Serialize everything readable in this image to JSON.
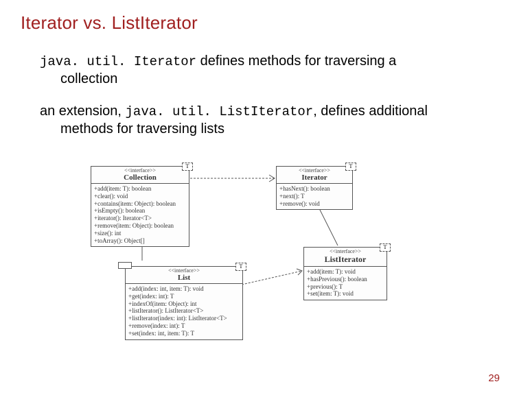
{
  "title": "Iterator vs. ListIterator",
  "para1": {
    "code1": "java. util. Iterator",
    "text1": " defines methods for traversing a",
    "text2": "collection"
  },
  "para2": {
    "lead": "an extension, ",
    "code1": "java. util. ListIterator",
    "mid": ", defines additional",
    "text2": "methods for traversing lists"
  },
  "uml": {
    "collection": {
      "stereo": "<<interface>>",
      "name": "Collection",
      "members": "+add(item: T): boolean\n+clear(): void\n+contains(item: Object): boolean\n+isEmpty(): boolean\n+iterator(): Iterator<T>\n+remove(item: Object): boolean\n+size(): int\n+toArray(): Object[]"
    },
    "iterator": {
      "stereo": "<<interface>>",
      "name": "Iterator",
      "members": "+hasNext(): boolean\n+next(): T\n+remove(): void"
    },
    "list": {
      "stereo": "<<interface>>",
      "name": "List",
      "members": "+add(index: int, item: T): void\n+get(index: int): T\n+indexOf(item: Object): int\n+listIterator(): ListIterator<T>\n+listIterator(index: int): ListIterator<T>\n+remove(index: int): T\n+set(index: int, item: T): T"
    },
    "listiterator": {
      "stereo": "<<interface>>",
      "name": "ListIterator",
      "members": "+add(item: T): void\n+hasPrevious(): boolean\n+previous(): T\n+set(item: T): void"
    },
    "type_param": "T"
  },
  "page_number": "29"
}
